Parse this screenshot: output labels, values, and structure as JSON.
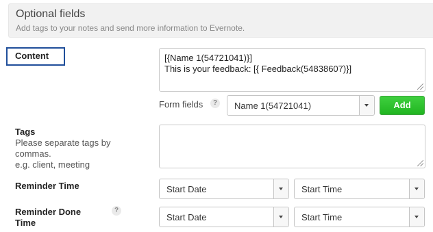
{
  "header": {
    "title": "Optional fields",
    "description": "Add tags to your notes and send more information to Evernote."
  },
  "content": {
    "label": "Content",
    "value": "[{Name 1(54721041)}]\nThis is your feedback: [{ Feedback(54838607)}]",
    "form_fields_label": "Form fields",
    "help_icon": "?",
    "form_field_selected": "Name 1(54721041)",
    "add_label": "Add"
  },
  "tags": {
    "label": "Tags",
    "hint_line1": "Please separate tags by",
    "hint_line2": "commas.",
    "hint_line3": "e.g. client, meeting",
    "value": ""
  },
  "reminder_time": {
    "label": "Reminder Time",
    "date_selected": "Start Date",
    "time_selected": "Start Time"
  },
  "reminder_done_time": {
    "label_line1": "Reminder Done",
    "label_line2": "Time",
    "help_icon": "?",
    "date_selected": "Start Date",
    "time_selected": "Start Time"
  },
  "colors": {
    "highlight_border": "#1f4e9a",
    "add_button": "#2cc02c",
    "header_bg": "#f1f1f1"
  }
}
